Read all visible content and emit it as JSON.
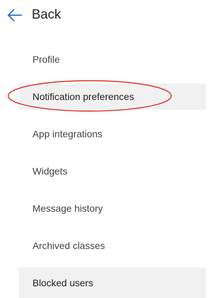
{
  "nav": {
    "back_label": "Back",
    "back_icon": "arrow-left-icon",
    "accent_color": "#2c6ecb"
  },
  "menu": {
    "items": [
      {
        "label": "Profile"
      },
      {
        "label": "Notification preferences"
      },
      {
        "label": "App integrations"
      },
      {
        "label": "Widgets"
      },
      {
        "label": "Message history"
      },
      {
        "label": "Archived classes"
      },
      {
        "label": "Blocked users"
      }
    ]
  },
  "annotation": {
    "color": "#d93025",
    "target": "Notification preferences"
  }
}
